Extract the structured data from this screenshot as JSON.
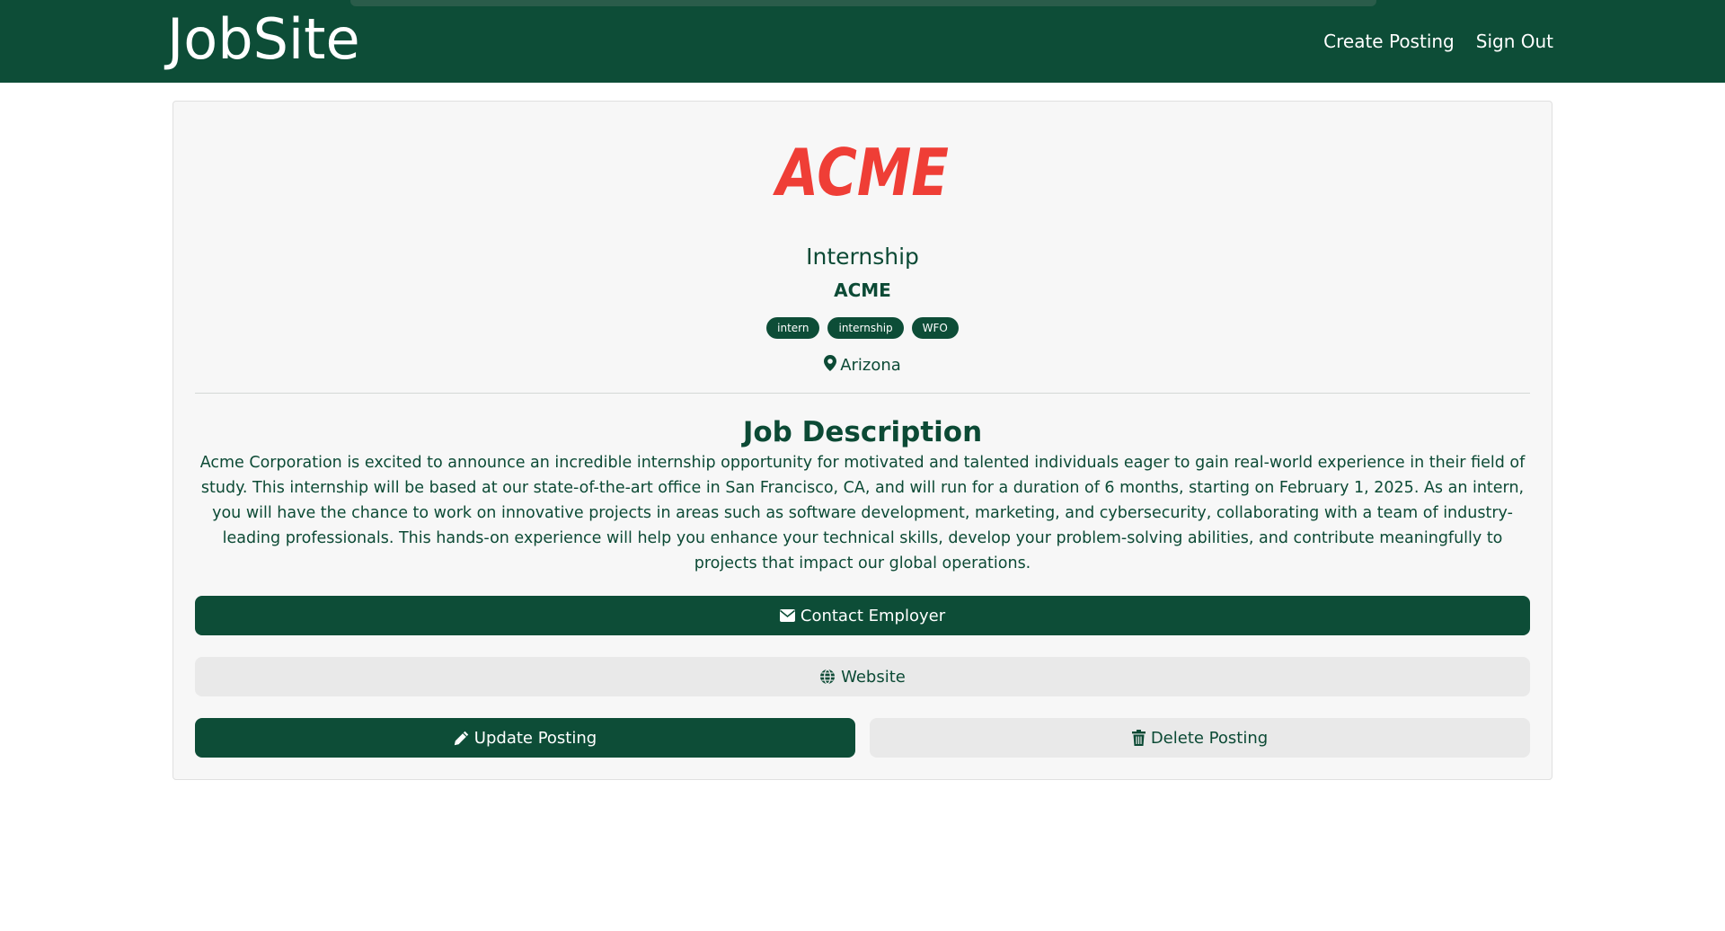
{
  "navbar": {
    "brand": "JobSite",
    "links": [
      "Create Posting",
      "Sign Out"
    ]
  },
  "posting": {
    "logo_text": "ACME",
    "title": "Internship",
    "company": "ACME",
    "tags": [
      "intern",
      "internship",
      "WFO"
    ],
    "location": "Arizona",
    "description_heading": "Job Description",
    "description": "Acme Corporation is excited to announce an incredible internship opportunity for motivated and talented individuals eager to gain real-world experience in their field of study. This internship will be based at our state-of-the-art office in San Francisco, CA, and will run for a duration of 6 months, starting on February 1, 2025. As an intern, you will have the chance to work on innovative projects in areas such as software development, marketing, and cybersecurity, collaborating with a team of industry-leading professionals. This hands-on experience will help you enhance your technical skills, develop your problem-solving abilities, and contribute meaningfully to projects that impact our global operations."
  },
  "actions": {
    "contact": "Contact Employer",
    "website": "Website",
    "update": "Update Posting",
    "delete": "Delete Posting"
  },
  "icons": {
    "location": "map-pin-icon",
    "contact": "envelope-icon",
    "website": "globe-icon",
    "update": "pencil-icon",
    "delete": "trash-icon"
  },
  "colors": {
    "primary": "#0d4d37",
    "logo": "#ef3e36",
    "light_button": "#e9e9e9"
  }
}
